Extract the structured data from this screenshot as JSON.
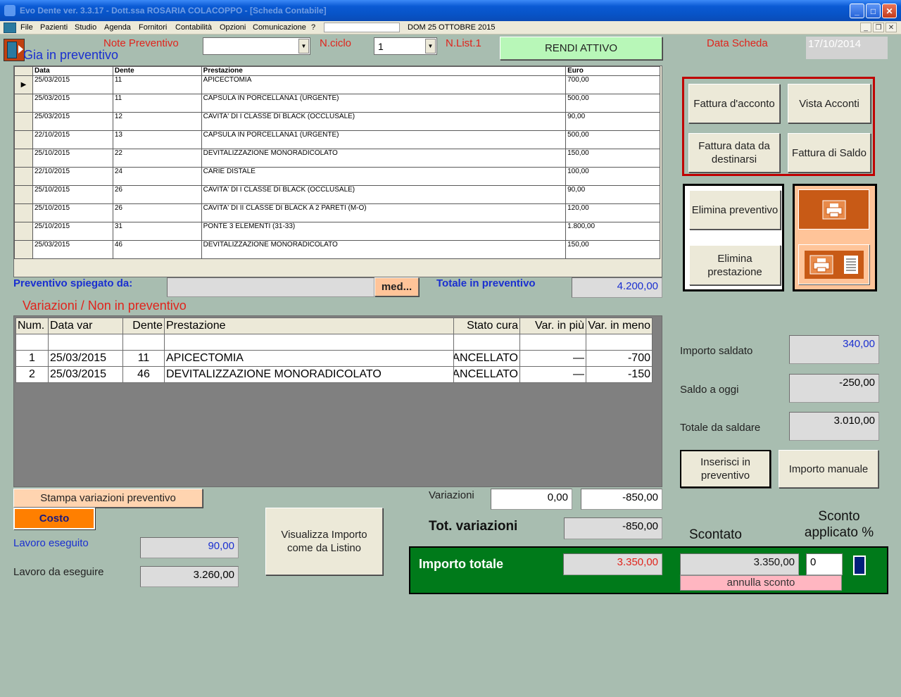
{
  "window": {
    "title": "Evo Dente ver. 3.3.17 - Dott.ssa ROSARIA COLACOPPO - [Scheda Contabile]",
    "minimize": "_",
    "maximize": "□",
    "close": "✕"
  },
  "menu": {
    "items": [
      "File",
      "Pazienti",
      "Studio",
      "Agenda",
      "Fornitori",
      "Contabilità",
      "Opzioni",
      "Comunicazione",
      "?"
    ],
    "date": "DOM 25 OTTOBRE 2015"
  },
  "header": {
    "gia_in_preventivo": "Gia in preventivo",
    "note_preventivo": "Note Preventivo",
    "note_value": "",
    "n_ciclo": "N.ciclo",
    "n_ciclo_value": "1",
    "n_list": "N.List.1",
    "rendi_attivo": "RENDI ATTIVO",
    "data_scheda": "Data Scheda",
    "data_scheda_value": "17/10/2014"
  },
  "preventivo_table": {
    "headers": [
      "Data",
      "Dente",
      "Prestazione",
      "Euro"
    ],
    "rows": [
      [
        "25/03/2015",
        "11",
        "APICECTOMIA",
        "700,00"
      ],
      [
        "25/03/2015",
        "11",
        "CAPSULA IN PORCELLANA1 (URGENTE)",
        "500,00"
      ],
      [
        "25/03/2015",
        "12",
        "CAVITA' DI I CLASSE DI BLACK (OCCLUSALE)",
        "90,00"
      ],
      [
        "22/10/2015",
        "13",
        "CAPSULA IN PORCELLANA1 (URGENTE)",
        "500,00"
      ],
      [
        "25/10/2015",
        "22",
        "DEVITALIZZAZIONE MONORADICOLATO",
        "150,00"
      ],
      [
        "22/10/2015",
        "24",
        "CARIE DISTALE",
        "100,00"
      ],
      [
        "25/10/2015",
        "26",
        "CAVITA' DI I CLASSE DI BLACK (OCCLUSALE)",
        "90,00"
      ],
      [
        "25/10/2015",
        "26",
        "CAVITA' DI II CLASSE DI BLACK A 2 PARETI (M-O)",
        "120,00"
      ],
      [
        "25/10/2015",
        "31",
        "PONTE 3 ELEMENTI (31-33)",
        "1.800,00"
      ],
      [
        "25/03/2015",
        "46",
        "DEVITALIZZAZIONE MONORADICOLATO",
        "150,00"
      ]
    ]
  },
  "spiegato": {
    "label": "Preventivo spiegato da:",
    "value": "",
    "med_button": "med...",
    "totale_label": "Totale in preventivo",
    "totale_value": "4.200,00"
  },
  "variazioni": {
    "title": "Variazioni / Non in preventivo",
    "headers": [
      "Num.",
      "Data var",
      "Dente",
      "Prestazione",
      "Stato cura",
      "Var. in più",
      "Var. in meno"
    ],
    "rows": [
      [
        "1",
        "25/03/2015",
        "11",
        "APICECTOMIA",
        "CANCELLATO",
        "—",
        "-700"
      ],
      [
        "2",
        "25/03/2015",
        "46",
        "DEVITALIZZAZIONE MONORADICOLATO",
        "CANCELLATO",
        "—",
        "-150"
      ]
    ]
  },
  "bottom_left": {
    "stampa_variazioni": "Stampa variazioni preventivo",
    "costo": "Costo",
    "lavoro_eseguito": "Lavoro eseguito",
    "lavoro_eseguito_value": "90,00",
    "lavoro_da_eseguire": "Lavoro da eseguire",
    "lavoro_da_eseguire_value": "3.260,00",
    "visualizza": "Visualizza Importo come da Listino"
  },
  "variazioni_totals": {
    "label": "Variazioni",
    "piu": "0,00",
    "meno": "-850,00",
    "tot_label": "Tot. variazioni",
    "tot_value": "-850,00"
  },
  "right_panel": {
    "fattura_acconto": "Fattura d'acconto",
    "vista_acconti": "Vista Acconti",
    "fattura_data": "Fattura data da destinarsi",
    "fattura_saldo": "Fattura di Saldo",
    "elimina_preventivo": "Elimina preventivo",
    "elimina_prestazione": "Elimina prestazione",
    "importo_saldato": "Importo saldato",
    "importo_saldato_value": "340,00",
    "saldo_oggi": "Saldo a oggi",
    "saldo_oggi_value": "-250,00",
    "totale_saldare": "Totale da saldare",
    "totale_saldare_value": "3.010,00",
    "inserisci": "Inserisci in preventivo",
    "importo_manuale": "Importo manuale",
    "scontato": "Scontato",
    "sconto_applicato": "Sconto applicato %"
  },
  "importo": {
    "label": "Importo totale",
    "value": "3.350,00",
    "scontato_value": "3.350,00",
    "sconto_value": "0",
    "annulla_sconto": "annulla sconto"
  },
  "colors": {
    "background": "#a8bdb0",
    "green_panel": "#007a1a",
    "accent_orange": "#ff7f00",
    "light_green_button": "#b8f7b8"
  }
}
